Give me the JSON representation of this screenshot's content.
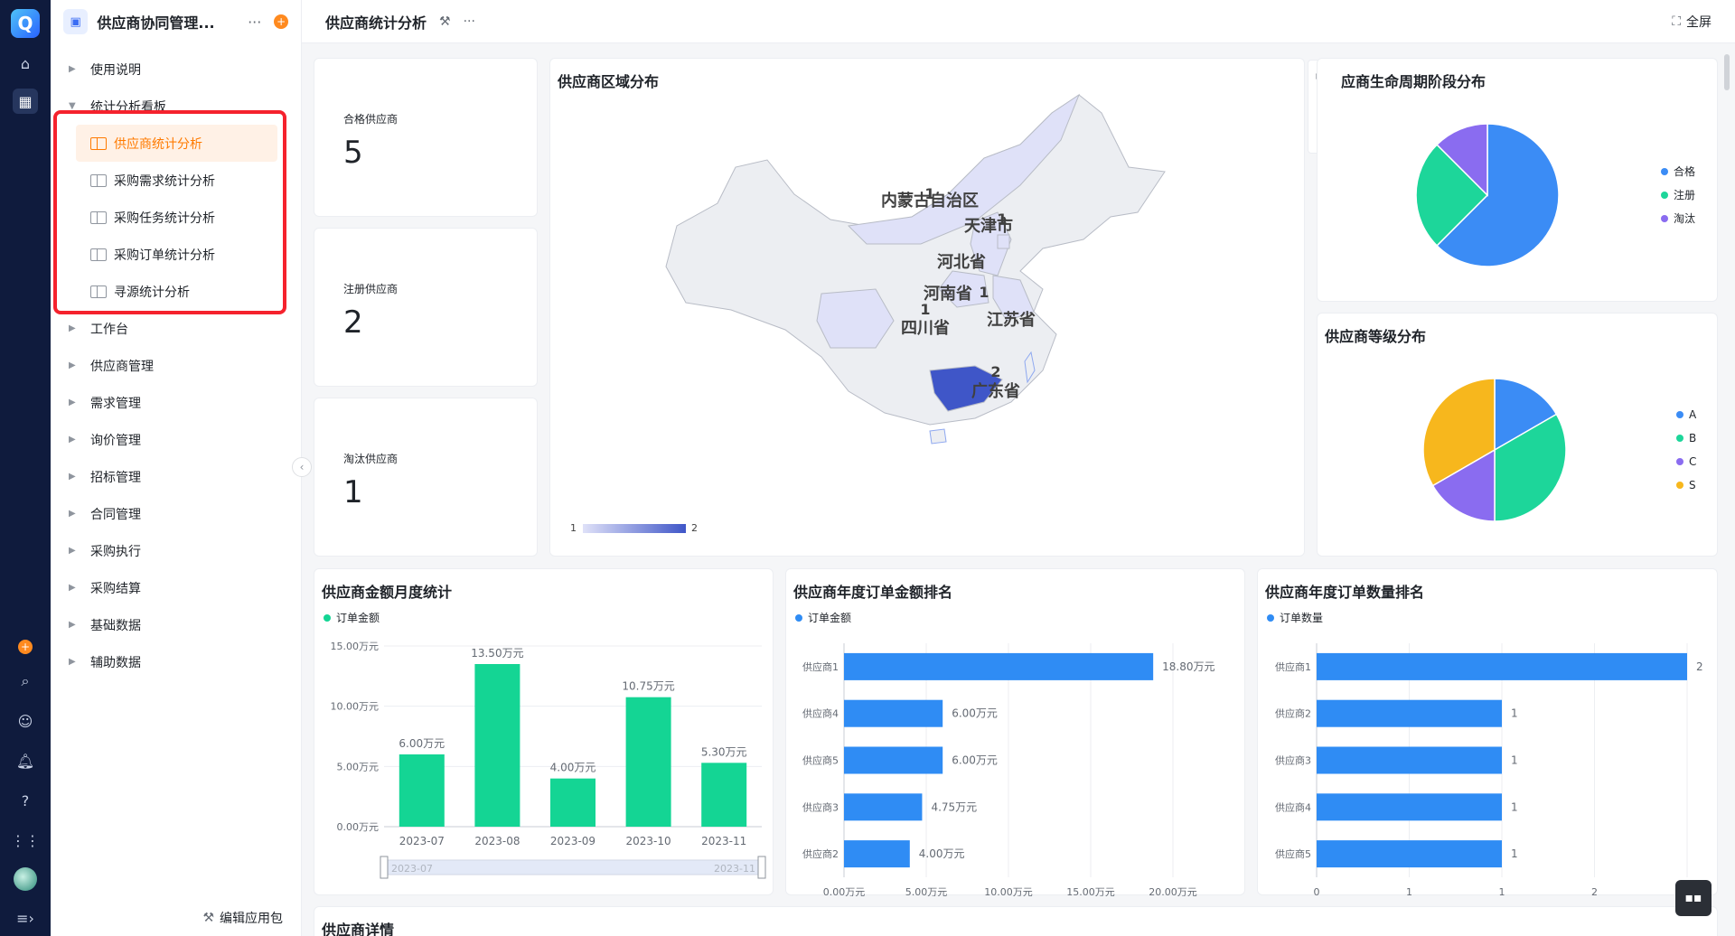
{
  "rail": {
    "logo": "Q"
  },
  "sidebar": {
    "app_title": "供应商协同管理...",
    "more": "···",
    "add": "+",
    "items_top": [
      {
        "label": "使用说明"
      },
      {
        "label": "统计分析看板"
      }
    ],
    "sub_items": [
      {
        "label": "供应商统计分析",
        "active": true
      },
      {
        "label": "采购需求统计分析"
      },
      {
        "label": "采购任务统计分析"
      },
      {
        "label": "采购订单统计分析"
      },
      {
        "label": "寻源统计分析"
      }
    ],
    "items_bottom": [
      {
        "label": "工作台"
      },
      {
        "label": "供应商管理"
      },
      {
        "label": "需求管理"
      },
      {
        "label": "询价管理"
      },
      {
        "label": "招标管理"
      },
      {
        "label": "合同管理"
      },
      {
        "label": "采购执行"
      },
      {
        "label": "采购结算"
      },
      {
        "label": "基础数据"
      },
      {
        "label": "辅助数据"
      }
    ],
    "edit_package": "编辑应用包"
  },
  "topbar": {
    "title": "供应商统计分析",
    "more": "···",
    "fullscreen": "全屏"
  },
  "stats": [
    {
      "label": "合格供应商",
      "value": "5"
    },
    {
      "label": "注册供应商",
      "value": "2"
    },
    {
      "label": "淘汰供应商",
      "value": "1"
    }
  ],
  "map": {
    "title": "供应商区域分布",
    "regions": [
      {
        "name": "内蒙古自治区",
        "value": "1"
      },
      {
        "name": "天津市",
        "value": "1"
      },
      {
        "name": "河北省",
        "value": "1"
      },
      {
        "name": "河南省",
        "value": "1"
      },
      {
        "name": "江苏省",
        "value": "1"
      },
      {
        "name": "四川省",
        "value": "1"
      },
      {
        "name": "广东省",
        "value": "2"
      }
    ],
    "scale_min": "1",
    "scale_max": "2",
    "colors": {
      "low": "#dfe1f8",
      "high": "#3f56c8"
    }
  },
  "lifecycle": {
    "title": "供应商生命周期阶段分布",
    "display_title": "应商生命周期阶段分布",
    "chart_data": {
      "type": "pie",
      "categories": [
        "合格",
        "注册",
        "淘汰"
      ],
      "values": [
        5,
        2,
        1
      ],
      "colors": [
        "#3b8cf5",
        "#1dd69a",
        "#8a6cf0"
      ]
    }
  },
  "grade": {
    "title": "供应商等级分布",
    "chart_data": {
      "type": "pie",
      "categories": [
        "A",
        "B",
        "C",
        "S"
      ],
      "values": [
        1,
        2,
        1,
        2
      ],
      "colors": [
        "#3b8cf5",
        "#1dd69a",
        "#8a6cf0",
        "#f7b71d"
      ]
    }
  },
  "monthly": {
    "title": "供应商金额月度统计",
    "legend": "订单金额",
    "chart_data": {
      "type": "bar",
      "categories": [
        "2023-07",
        "2023-08",
        "2023-09",
        "2023-10",
        "2023-11"
      ],
      "values": [
        6.0,
        13.5,
        4.0,
        10.75,
        5.3
      ],
      "labels": [
        "6.00万元",
        "13.50万元",
        "4.00万元",
        "10.75万元",
        "5.30万元"
      ],
      "yticks": [
        "0.00万元",
        "5.00万元",
        "10.00万元",
        "15.00万元"
      ],
      "ylim": [
        0,
        15
      ],
      "color": "#14d594"
    },
    "slider_start": "2023-07",
    "slider_end": "2023-11"
  },
  "amount_rank": {
    "title": "供应商年度订单金额排名",
    "legend": "订单金额",
    "chart_data": {
      "type": "bar",
      "categories": [
        "供应商1",
        "供应商4",
        "供应商5",
        "供应商3",
        "供应商2"
      ],
      "values": [
        18.8,
        6.0,
        6.0,
        4.75,
        4.0
      ],
      "labels": [
        "18.80万元",
        "6.00万元",
        "6.00万元",
        "4.75万元",
        "4.00万元"
      ],
      "xticks": [
        "0.00万元",
        "5.00万元",
        "10.00万元",
        "15.00万元",
        "20.00万元"
      ],
      "xlim": [
        0,
        20
      ],
      "color": "#2f8cf4"
    }
  },
  "count_rank": {
    "title": "供应商年度订单数量排名",
    "legend": "订单数量",
    "chart_data": {
      "type": "bar",
      "categories": [
        "供应商1",
        "供应商2",
        "供应商3",
        "供应商4",
        "供应商5"
      ],
      "values": [
        2,
        1,
        1,
        1,
        1
      ],
      "labels": [
        "2",
        "1",
        "1",
        "1",
        "1"
      ],
      "xticks": [
        "0",
        "1",
        "1",
        "2",
        "2"
      ],
      "xlim": [
        0,
        2
      ],
      "color": "#2f8cf4"
    }
  },
  "details": {
    "title": "供应商详情"
  }
}
